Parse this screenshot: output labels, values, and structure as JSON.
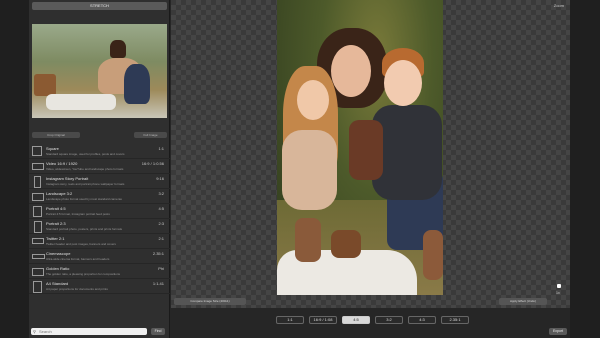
{
  "sidebar": {
    "title": "STRETCH",
    "thumb_buttons": [
      "Crop Original",
      "Full Image"
    ],
    "presets": [
      {
        "name": "Square",
        "desc": "Standard square image, used for profiles, posts and covers",
        "ratio": "1:1",
        "icon": "square-icon"
      },
      {
        "name": "Video 16:9 / 1920",
        "desc": "Video, widescreen, YouTube and landscape photo formats",
        "ratio": "16:9 / 1:0.56",
        "icon": "landscape-icon"
      },
      {
        "name": "Instagram Story Portrait",
        "desc": "Instagram story, reels and portrait phone wallpaper formats",
        "ratio": "9:16",
        "icon": "portrait-icon"
      },
      {
        "name": "Landscape 3:2",
        "desc": "Landscape photo format used by most standard cameras",
        "ratio": "3:2",
        "icon": "landscape-icon"
      },
      {
        "name": "Portrait 4:5",
        "desc": "Portrait 4:5 format, Instagram portrait feed posts",
        "ratio": "4:5",
        "icon": "portrait-icon"
      },
      {
        "name": "Portrait 2:3",
        "desc": "Standard portrait photo, posters, prints and prints formats",
        "ratio": "2:3",
        "icon": "portrait-icon"
      },
      {
        "name": "Twitter 2:1",
        "desc": "Twitter header and post images, banners and covers",
        "ratio": "2:1",
        "icon": "landscape-icon"
      },
      {
        "name": "Cinemascope",
        "desc": "Ultra-wide cinema format, banners and headers",
        "ratio": "2.35:1",
        "icon": "wide-icon"
      },
      {
        "name": "Golden Ratio",
        "desc": "The golden ratio, a pleasing proportion for compositions",
        "ratio": "Phi",
        "icon": "golden-icon"
      },
      {
        "name": "A4 Standard",
        "desc": "A4 paper proportions for documents and prints",
        "ratio": "1:1.41",
        "icon": "page-icon"
      }
    ],
    "search_placeholder": "Search",
    "search_button": "Find"
  },
  "canvas": {
    "zoom_label": "Zoom",
    "handle_label": "1x",
    "left_button": "Compare Image Size (400x1)",
    "right_button": "Apply Effect (Undo)"
  },
  "toolbar": {
    "ratios": [
      "1:1",
      "16:9 / 1:08",
      "4:5",
      "3:2",
      "4:3",
      "2.35:1"
    ],
    "active_index": 2,
    "export_label": "Export"
  }
}
